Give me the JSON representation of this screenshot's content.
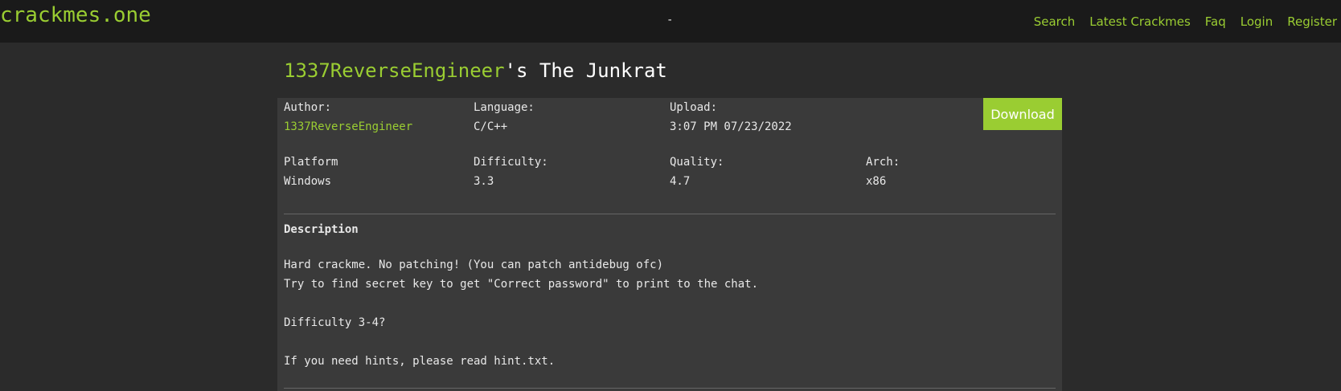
{
  "header": {
    "logo": "crackmes.one",
    "center": "-",
    "nav": [
      "Search",
      "Latest Crackmes",
      "Faq",
      "Login",
      "Register"
    ]
  },
  "title": {
    "author": "1337ReverseEngineer",
    "suffix": "'s The Junkrat"
  },
  "info": {
    "author_label": "Author:",
    "author_value": "1337ReverseEngineer",
    "language_label": "Language:",
    "language_value": "C/C++",
    "upload_label": "Upload:",
    "upload_value": "3:07 PM 07/23/2022",
    "platform_label": "Platform",
    "platform_value": "Windows",
    "difficulty_label": "Difficulty:",
    "difficulty_value": "3.3",
    "quality_label": "Quality:",
    "quality_value": "4.7",
    "arch_label": "Arch:",
    "arch_value": "x86"
  },
  "download_label": "Download",
  "description": {
    "heading": "Description",
    "lines": [
      "Hard crackme. No patching! (You can patch antidebug ofc)",
      "Try to find secret key to get \"Correct password\" to print to the chat.",
      "Difficulty 3-4?",
      "If you need hints, please read hint.txt."
    ]
  },
  "colors": {
    "accent": "#9acd32",
    "background": "#2b2b2b",
    "panel": "#3a3a3a",
    "topbar": "#1a1a1a"
  }
}
